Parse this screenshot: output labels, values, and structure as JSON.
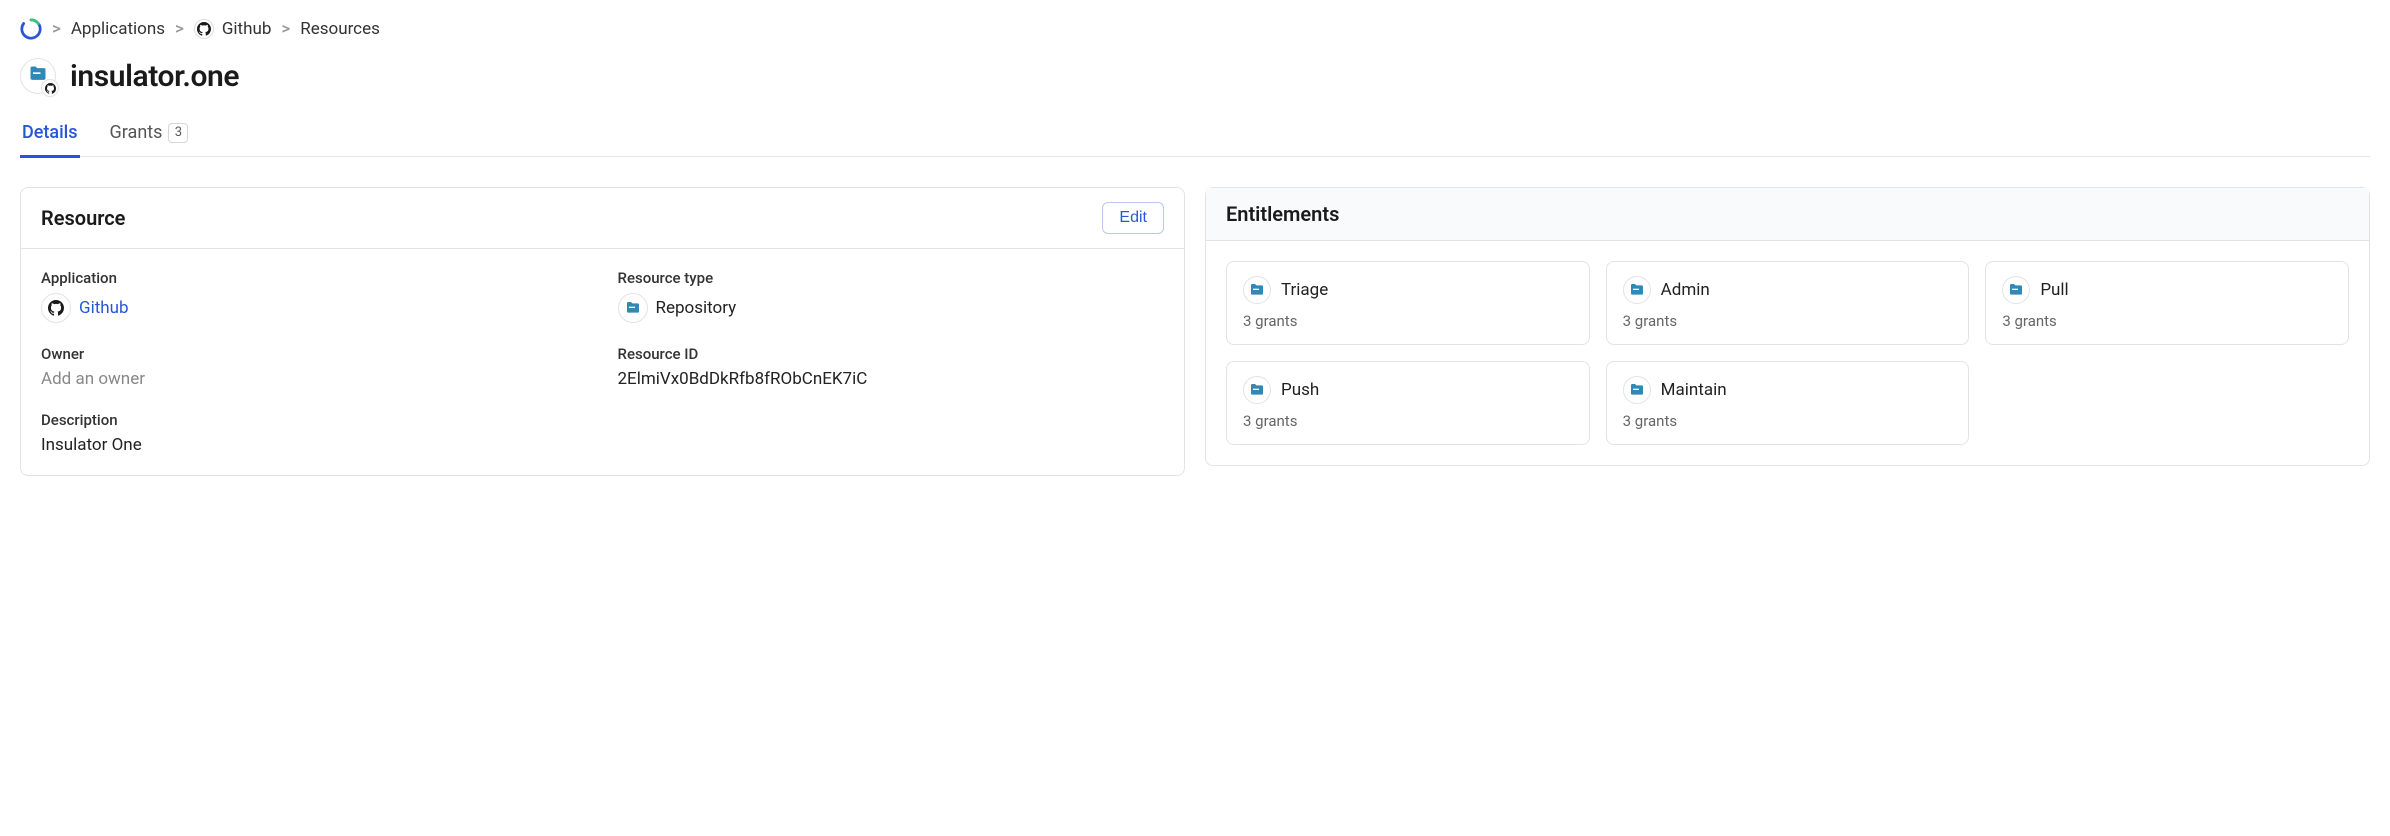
{
  "breadcrumb": {
    "items": [
      {
        "label": "Applications"
      },
      {
        "label": "Github"
      },
      {
        "label": "Resources"
      }
    ]
  },
  "page": {
    "title": "insulator.one"
  },
  "tabs": {
    "details_label": "Details",
    "grants_label": "Grants",
    "grants_count": "3"
  },
  "resource": {
    "header": "Resource",
    "edit_label": "Edit",
    "application_label": "Application",
    "application_value": "Github",
    "resource_type_label": "Resource type",
    "resource_type_value": "Repository",
    "owner_label": "Owner",
    "owner_placeholder": "Add an owner",
    "resource_id_label": "Resource ID",
    "resource_id_value": "2ElmiVx0BdDkRfb8fRObCnEK7iC",
    "description_label": "Description",
    "description_value": "Insulator One"
  },
  "entitlements": {
    "header": "Entitlements",
    "cards": [
      {
        "title": "Triage",
        "sub": "3 grants"
      },
      {
        "title": "Admin",
        "sub": "3 grants"
      },
      {
        "title": "Pull",
        "sub": "3 grants"
      },
      {
        "title": "Push",
        "sub": "3 grants"
      },
      {
        "title": "Maintain",
        "sub": "3 grants"
      }
    ]
  }
}
